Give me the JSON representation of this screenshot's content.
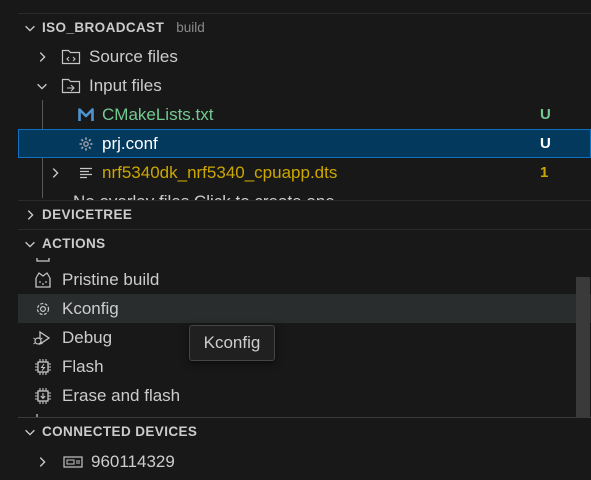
{
  "workspace": {
    "title": "ISO_BROADCAST",
    "description": "build",
    "items": [
      {
        "label": "Source files"
      },
      {
        "label": "Input files"
      },
      {
        "label": "CMakeLists.txt",
        "badge": "U"
      },
      {
        "label": "prj.conf",
        "badge": "U"
      },
      {
        "label": "nrf5340dk_nrf5340_cpuapp.dts",
        "badge": "1"
      },
      {
        "label": "No overlay files Click to create one"
      }
    ]
  },
  "devicetree": {
    "title": "DEVICETREE"
  },
  "actions": {
    "title": "ACTIONS",
    "items": [
      {
        "label": "Pristine build"
      },
      {
        "label": "Kconfig"
      },
      {
        "label": "Debug"
      },
      {
        "label": "Flash"
      },
      {
        "label": "Erase and flash"
      }
    ],
    "tooltip": "Kconfig"
  },
  "connected_devices": {
    "title": "CONNECTED DEVICES",
    "items": [
      {
        "label": "960114329"
      }
    ]
  },
  "colors": {
    "untracked_green": "#73c991",
    "warning_yellow": "#cca700",
    "selection_bg": "#04395e",
    "selection_border": "#0e70c0"
  },
  "icons": [
    "chevron-down-icon",
    "chevron-right-icon",
    "folder-icon",
    "cmake-m-icon",
    "gear-icon",
    "lines-icon",
    "build-icon",
    "debug-icon",
    "chip-icon",
    "board-icon"
  ]
}
